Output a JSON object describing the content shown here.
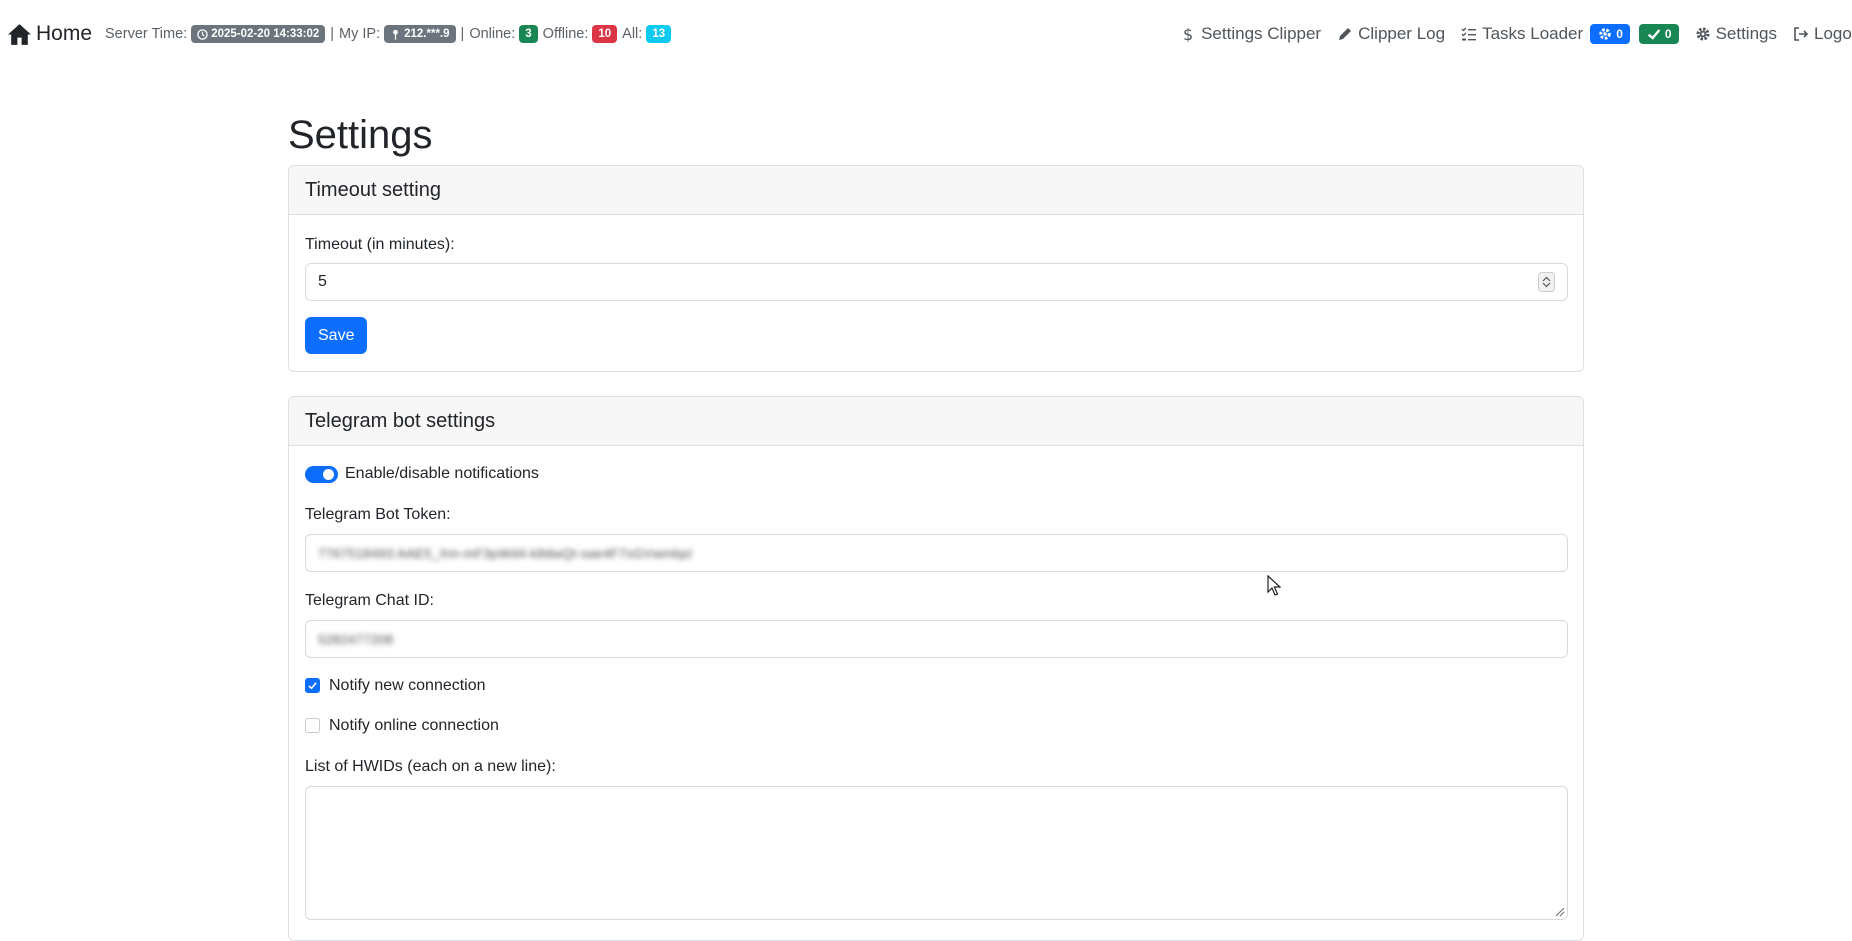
{
  "navbar": {
    "brand": "Home",
    "server_time_label": "Server Time:",
    "server_time": "2025-02-20 14:33:02",
    "separator": "|",
    "my_ip_label": "My IP:",
    "my_ip": "212.***.9",
    "online_label": "Online:",
    "online_count": "3",
    "offline_label": "Offline:",
    "offline_count": "10",
    "all_label": "All:",
    "all_count": "13",
    "links": {
      "settings_clipper": "Settings Clipper",
      "clipper_log": "Clipper Log",
      "tasks_loader": "Tasks Loader",
      "tasks_running": "0",
      "tasks_done": "0",
      "settings": "Settings",
      "logout": "Logout"
    }
  },
  "page": {
    "title": "Settings"
  },
  "timeout_card": {
    "header": "Timeout setting",
    "timeout_label": "Timeout (in minutes):",
    "timeout_value": "5",
    "save_label": "Save"
  },
  "telegram_card": {
    "header": "Telegram bot settings",
    "toggle_label": "Enable/disable notifications",
    "toggle_on": true,
    "bot_token_label": "Telegram Bot Token:",
    "bot_token_value": "7767518493:AAE5_Xm-mF3pWd4-k8dwQt-sae4F7sGVwmbpI",
    "chat_id_label": "Telegram Chat ID:",
    "chat_id_value": "5282477208",
    "notify_new_label": "Notify new connection",
    "notify_new_checked": true,
    "notify_online_label": "Notify online connection",
    "notify_online_checked": false,
    "hwids_label": "List of HWIDs (each on a new line):",
    "hwids_value": ""
  },
  "colors": {
    "primary": "#0d6efd",
    "success": "#198754",
    "danger": "#dc3545",
    "info": "#0dcaf0",
    "secondary": "#6c757d"
  },
  "icons": [
    "home-icon",
    "clock-icon",
    "pin-icon",
    "dollar-icon",
    "pencil-icon",
    "list-check-icon",
    "gear-icon",
    "check-icon",
    "logout-icon"
  ]
}
